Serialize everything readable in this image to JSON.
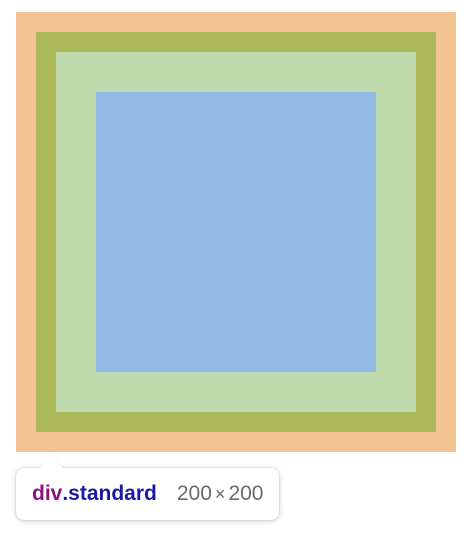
{
  "colors": {
    "margin": "#f4c393",
    "border": "#acb95b",
    "padding": "#bfdaad",
    "content": "#93b8e3",
    "tag": "#881280",
    "class": "#1a1aa6",
    "dims": "#6b6b6b"
  },
  "tooltip": {
    "tag": "div",
    "class": ".standard",
    "width": "200",
    "times": "×",
    "height": "200"
  }
}
